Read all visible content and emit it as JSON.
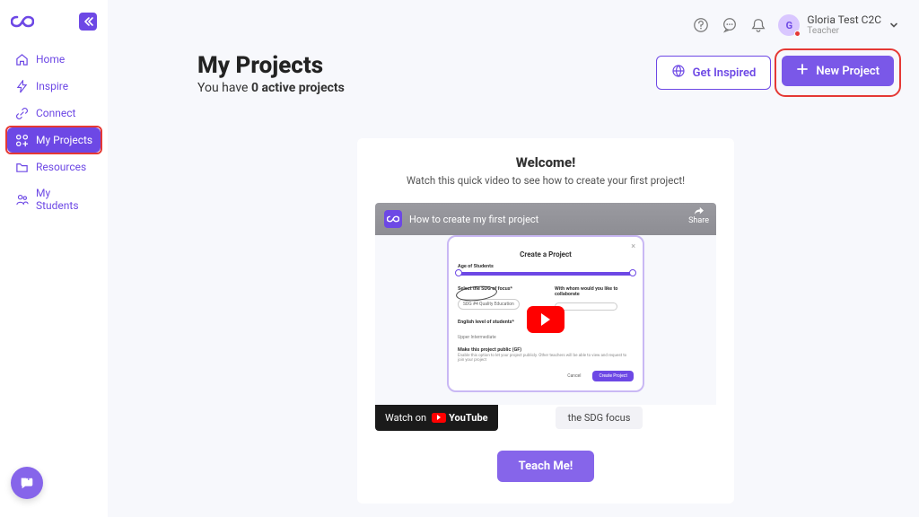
{
  "sidebar": {
    "items": [
      {
        "label": "Home"
      },
      {
        "label": "Inspire"
      },
      {
        "label": "Connect"
      },
      {
        "label": "My Projects"
      },
      {
        "label": "Resources"
      },
      {
        "label": "My Students"
      }
    ]
  },
  "topbar": {
    "user_initial": "G",
    "user_name": "Gloria Test C2C",
    "user_role": "Teacher"
  },
  "header": {
    "title": "My Projects",
    "subtitle_prefix": "You have ",
    "subtitle_count": "0 active projects",
    "get_inspired": "Get Inspired",
    "new_project": "New Project"
  },
  "welcome": {
    "title": "Welcome!",
    "subtitle": "Watch this quick video to see how to create your first project!",
    "video_title": "How to create my first project",
    "share": "Share",
    "watch_on": "Watch on",
    "youtube": "YouTube",
    "sdg_tag": "the SDG focus",
    "teach_me": "Teach Me!",
    "form": {
      "pre": "Create a Project",
      "title": "Create a Project",
      "age_label": "Age of Students",
      "sdg_label": "Select the SDG of focus*",
      "sdg_value": "SDG #4 Quality Education",
      "collab_label": "With whom would you like to collaborate",
      "english_label": "English level of students*",
      "english_value": "Upper Intermediate",
      "public_label": "Make this project public (GF)",
      "public_desc": "Enable this option to let your project publicly. Other teachers will be able to view and request to join your project",
      "cancel": "Cancel",
      "create": "Create Project"
    }
  }
}
